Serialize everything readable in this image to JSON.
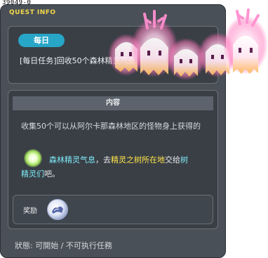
{
  "quest_id": "39049-0",
  "window_title": "QUEST INFO",
  "top_panel": {
    "tag": "每日",
    "quest_name": "[每日任务]回收50个森林精灵气息"
  },
  "content": {
    "header": "内容",
    "description": "收集50个可以从阿尔卡那森林地区的怪物身上获得的",
    "item_name": "森林精灵气息",
    "mid_text": "，去",
    "location": "精灵之树所在地",
    "end_text_1": "交给",
    "target_1": "树",
    "target_2": "精灵们",
    "end_text_2": "吧。"
  },
  "reward": {
    "label": "奖励"
  },
  "status": "狀態: 可開始 / 不可执行任務",
  "colors": {
    "window_bg": "#4a5058",
    "tag_bg": "#27a6c7",
    "title": "#f2d94a",
    "highlight_cyan": "#7ee8f5",
    "highlight_yellow": "#ffe44a"
  },
  "icons": {
    "item": "green-orb-icon",
    "reward": "reward-emblem-icon"
  }
}
